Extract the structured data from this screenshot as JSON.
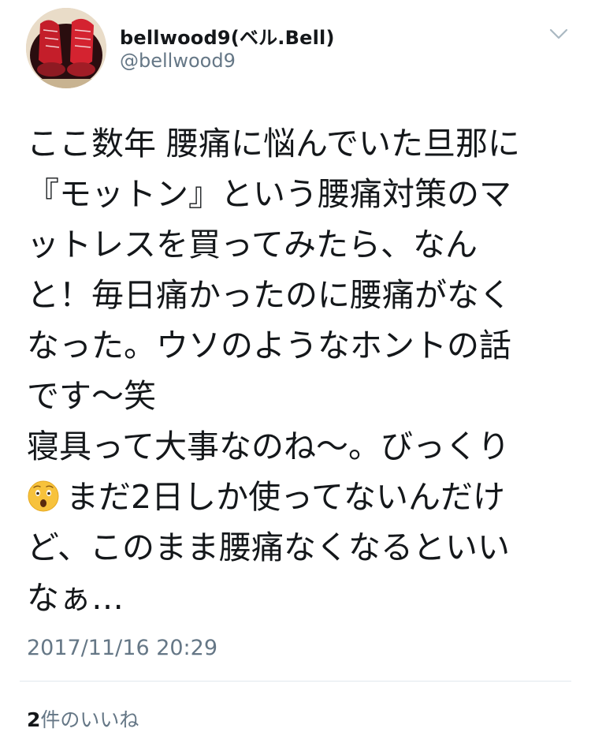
{
  "user": {
    "display_name": "bellwood9(ベル.Bell)",
    "handle": "@bellwood9",
    "avatar_icon": "avatar-red-boots-photo"
  },
  "menu": {
    "icon": "chevron-down-icon"
  },
  "tweet": {
    "lines": [
      "ここ数年 腰痛に悩んでいた旦那に",
      "『モットン』という腰痛対策のマ",
      "ットレスを買ってみたら、なん",
      "と！毎日痛かったのに腰痛がなく",
      "なった。ウソのようなホントの話",
      "です〜笑",
      "寝具って大事なのね〜。びっくり",
      "まだ2日しか使ってないんだけ",
      "ど、このまま腰痛なくなるといい",
      "なぁ…"
    ],
    "emoji_icon": "astonished-face-emoji",
    "timestamp": "2017/11/16 20:29"
  },
  "stats": {
    "likes_count": "2",
    "likes_label": "件のいいね"
  },
  "colors": {
    "text": "#14171a",
    "secondary": "#657786",
    "divider": "#e1e8ed"
  }
}
